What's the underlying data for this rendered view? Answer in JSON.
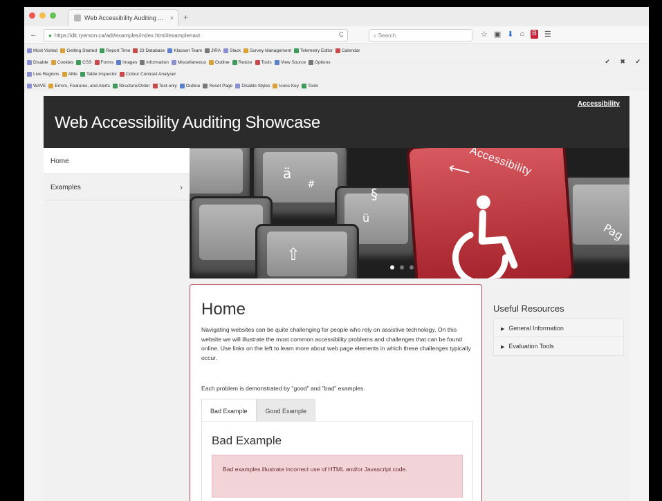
{
  "browser": {
    "tab_title": "Web Accessibility Auditing ...",
    "tab_close": "×",
    "new_tab": "+",
    "back": "←",
    "url": "https://dk.ryerson.ca/adt/examples/index.html#examplenavt",
    "reload": "C",
    "search_placeholder": "Search",
    "traffic_colors": [
      "#ee5a52",
      "#f5bf4f",
      "#61c454"
    ],
    "toolbar_icons": [
      "☆",
      "▣",
      "⬇",
      "⌂",
      "☰"
    ]
  },
  "bookmarks": {
    "row1": [
      "Most Visited",
      "Getting Started",
      "Report Time",
      "23 Database",
      "Klassen Team",
      "JIRA",
      "Slack",
      "Survey Management",
      "Telemetry Editor",
      "Calendar"
    ],
    "row2": [
      "Disable",
      "Cookies",
      "CSS",
      "Forms",
      "Images",
      "Information",
      "Miscellaneous",
      "Outline",
      "Resize",
      "Tools",
      "View Source",
      "Options"
    ],
    "row2_right": "✔ ✖ ✔",
    "row3": [
      "Live Regions",
      "AMe",
      "Table Inspector",
      "Colour Contrast Analyser"
    ],
    "row4": [
      "WAVE",
      "Errors, Features, and Alerts",
      "Structure/Order",
      "Text-only",
      "Outline",
      "Reset Page",
      "Disable Styles",
      "Icons Key",
      "Tools"
    ]
  },
  "site": {
    "title": "Web Accessibility Auditing Showcase",
    "accessibility_link": "Accessibility"
  },
  "sidenav": {
    "items": [
      {
        "label": "Home"
      },
      {
        "label": "Examples",
        "chevron": "›"
      }
    ]
  },
  "hero": {
    "key_labels": [
      "ä",
      "#",
      "§",
      "ü",
      "⇧"
    ],
    "red_key_text": "Accessibility",
    "side_key_text": "Pag",
    "arrow": "⟵"
  },
  "main": {
    "heading": "Home",
    "intro": "Navigating websites can be quite challenging for people who rely on assistive technology. On this website we will illustrate the most common accessibility problems and challenges that can be found online. Use links on the left to learn more about web page elements in which these challenges typically occur.",
    "intro2": "Each problem is demonstrated by \"good\" and \"bad\" examples.",
    "tabs": [
      "Bad Example",
      "Good Example"
    ],
    "panel_heading": "Bad Example",
    "panel_text": "Bad examples illustrate incorrect use of HTML and/or Javascript code."
  },
  "aside": {
    "heading": "Useful Resources",
    "items": [
      "General Information",
      "Evaluation Tools"
    ],
    "marker": "▶"
  }
}
